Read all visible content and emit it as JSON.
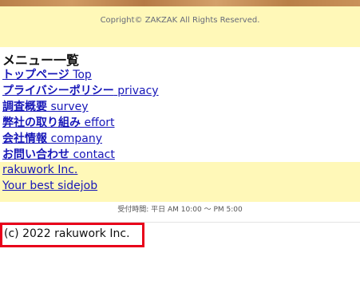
{
  "header": {
    "copyright": "Copright© ZAKZAK All Rights Reserved."
  },
  "menu": {
    "title": "メニュー一覧",
    "items": [
      {
        "jp": "トップページ",
        "en": "Top"
      },
      {
        "jp": "プライバシーポリシー",
        "en": "privacy"
      },
      {
        "jp": "調査概要",
        "en": "survey"
      },
      {
        "jp": "弊社の取り組み",
        "en": "effort"
      },
      {
        "jp": "会社情報",
        "en": "company"
      },
      {
        "jp": "お問い合わせ",
        "en": "contact"
      }
    ]
  },
  "brand": {
    "name": "rakuwork Inc.",
    "tagline": "Your best sidejob"
  },
  "hours": "受付時間: 平日 AM 10:00 〜 PM 5:00",
  "footer": {
    "copyright": "(c) 2022 rakuwork Inc."
  }
}
